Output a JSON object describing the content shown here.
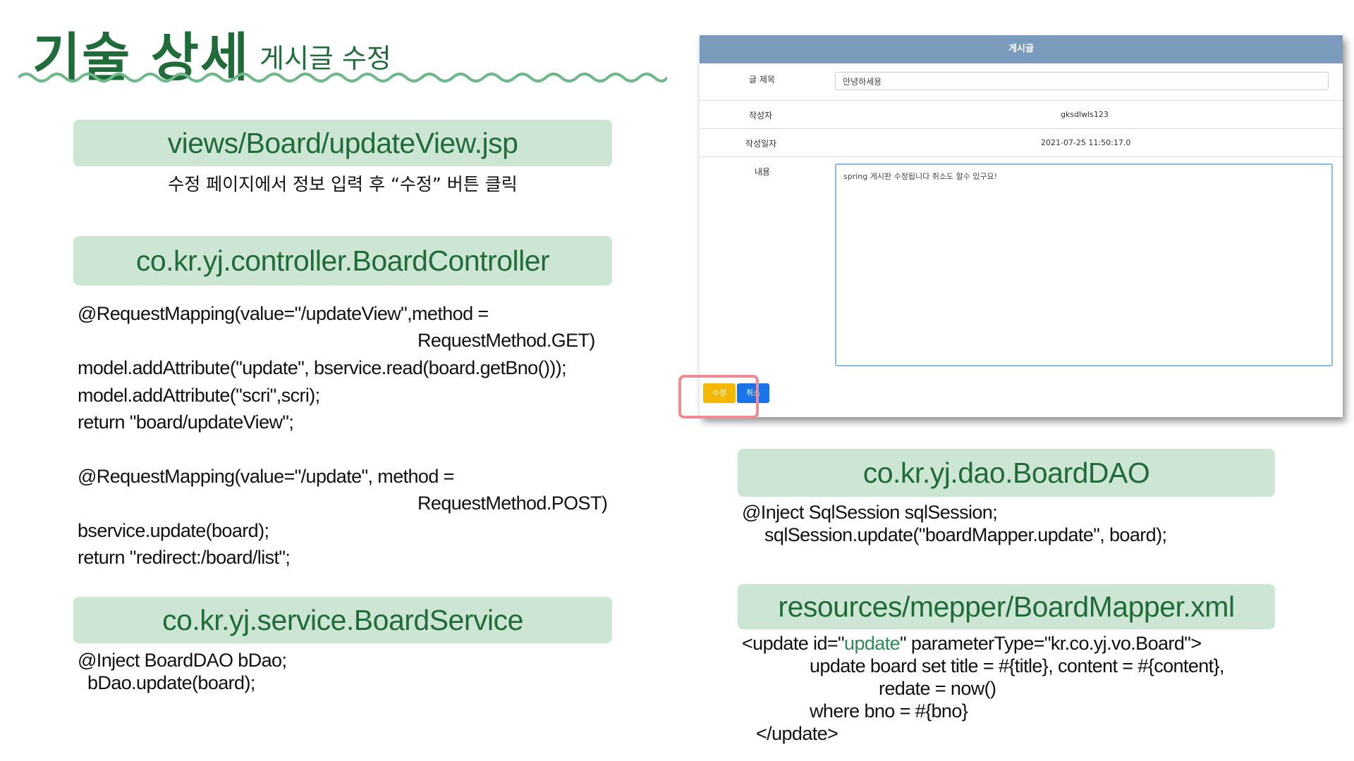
{
  "header": {
    "title": "기술 상세",
    "subtitle": "게시글 수정"
  },
  "sections": {
    "view": {
      "title": "views/Board/updateView.jsp",
      "caption": "수정 페이지에서 정보 입력 후 “수정” 버튼 클릭"
    },
    "controller": {
      "title": "co.kr.yj.controller.BoardController",
      "lines": [
        "@RequestMapping(value=\"/updateView\",method =",
        "RequestMethod.GET)",
        "model.addAttribute(\"update\", bservice.read(board.getBno()));",
        "model.addAttribute(\"scri\",scri);",
        "return \"board/updateView\";",
        "@RequestMapping(value=\"/update\", method =",
        "RequestMethod.POST)",
        "bservice.update(board);",
        "return \"redirect:/board/list\";"
      ]
    },
    "service": {
      "title": "co.kr.yj.service.BoardService",
      "lines": [
        "@Inject BoardDAO  bDao;",
        "bDao.update(board);"
      ]
    },
    "dao": {
      "title": "co.kr.yj.dao.BoardDAO",
      "lines": [
        "@Inject SqlSession sqlSession;",
        "sqlSession.update(\"boardMapper.update\", board);"
      ]
    },
    "mapper": {
      "title": "resources/mepper/BoardMapper.xml",
      "line1_pre": "<update id=\"",
      "line1_hl": "update",
      "line1_post": "\" parameterType=\"kr.co.yj.vo.Board\">",
      "lines": [
        "update board set title = #{title}, content = #{content},",
        "redate = now()",
        "where bno = #{bno}",
        "</update>"
      ]
    }
  },
  "screenshot": {
    "header": "게시글",
    "labels": {
      "title": "글 제목",
      "writer": "작성자",
      "date": "작성일자",
      "content": "내용"
    },
    "values": {
      "title": "안녕하세용",
      "writer": "gksdlwls123",
      "date": "2021-07-25 11:50:17.0",
      "content": "spring 게시판 수정됩니다 취소도 할수 있구요!"
    },
    "buttons": {
      "edit": "수정",
      "cancel": "취소"
    }
  },
  "colors": {
    "accent_green": "#1f6b3a",
    "banner_bg": "#cde6d4",
    "panel_header": "#7b9bbd",
    "edit_button": "#f5b800",
    "cancel_button": "#1a73e8",
    "focus_ring": "#f08a92"
  }
}
